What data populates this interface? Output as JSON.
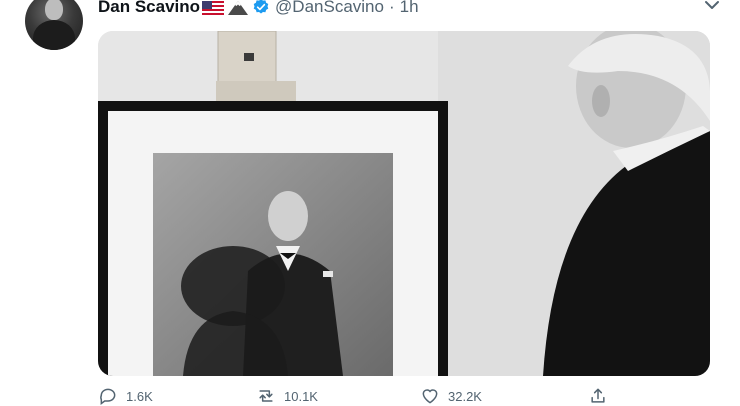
{
  "tweet": {
    "author_name": "Dan Scavino",
    "author_handle": "@DanScavino",
    "separator": "·",
    "time": "1h",
    "emoji_icons": [
      "us-flag-icon",
      "mountain-icon"
    ],
    "image_alt": "Photo: man in a dark suit looking at a framed black-and-white portrait on an easel"
  },
  "actions": {
    "replies": "1.6K",
    "retweets": "10.1K",
    "likes": "32.2K"
  },
  "colors": {
    "verified_blue": "#1d9bf0",
    "secondary_text": "#536471",
    "primary_text": "#0f1419"
  }
}
